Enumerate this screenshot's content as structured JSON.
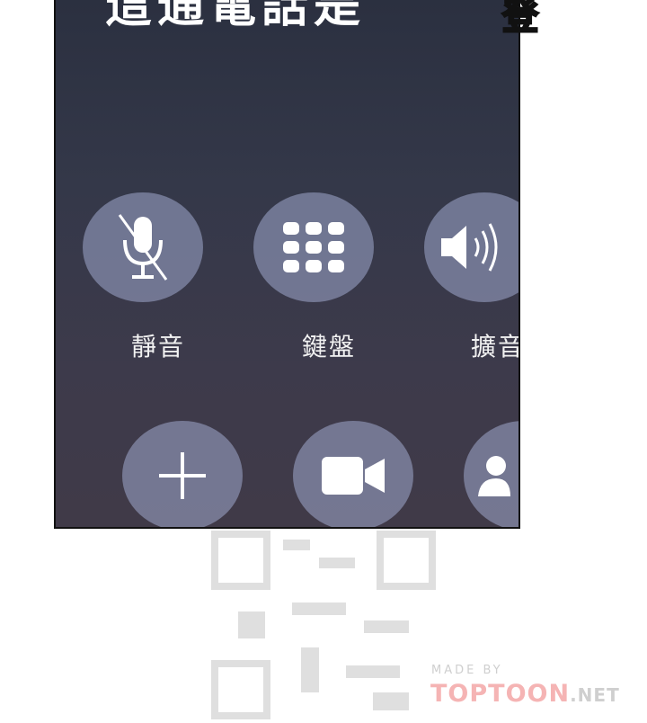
{
  "header": {
    "text": "這通電話是"
  },
  "sfx": {
    "text": "登"
  },
  "call_controls": {
    "mute": {
      "label": "靜音"
    },
    "keypad": {
      "label": "鍵盤"
    },
    "speaker": {
      "label": "擴音"
    }
  },
  "watermark": {
    "made_by": "MADE BY",
    "brand_left": "TOPTOON",
    "brand_right": ".NET"
  },
  "colors": {
    "panel_top": "#2b3040",
    "panel_bottom": "#403a48",
    "button_fill": "#a0aacd",
    "brand_pink": "#f5b4b4"
  }
}
